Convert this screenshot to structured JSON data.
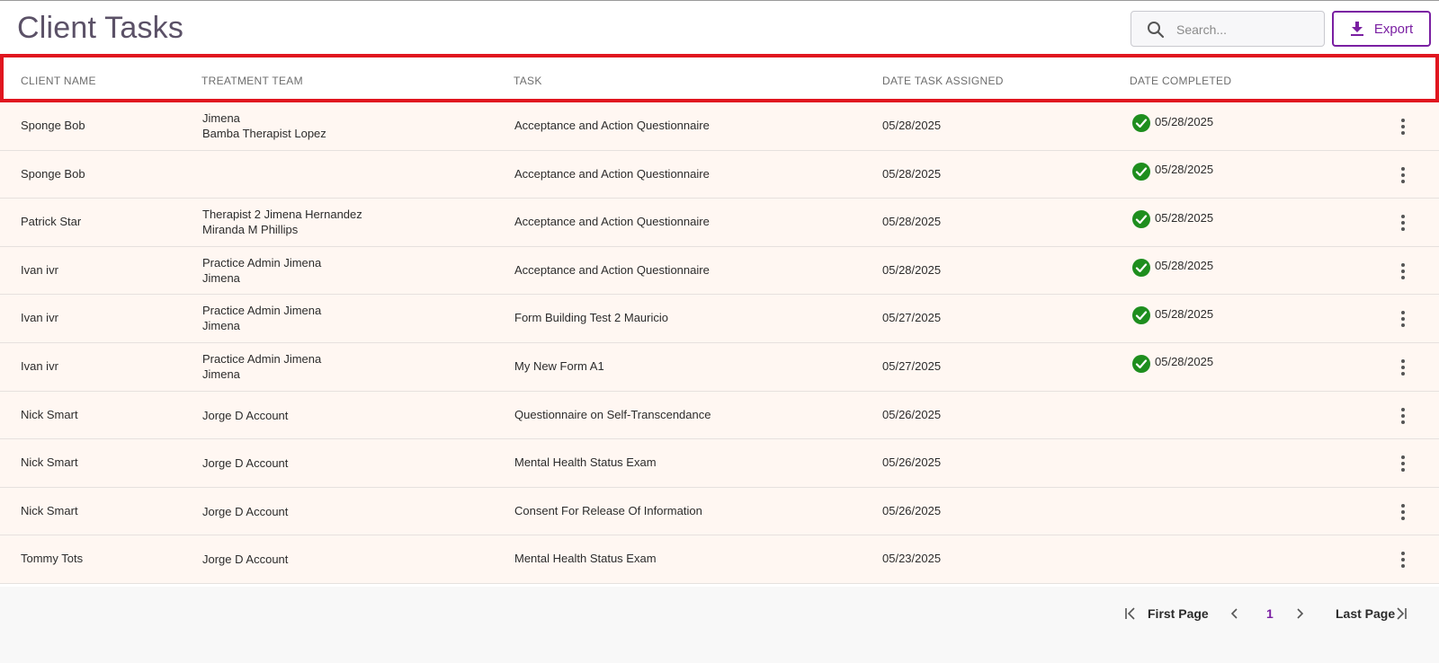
{
  "header": {
    "title": "Client Tasks",
    "search": {
      "placeholder": "Search...",
      "value": ""
    },
    "export_label": "Export"
  },
  "colors": {
    "accent": "#7a1fa2",
    "highlight_border": "#e0161f",
    "row_bg": "#fff7f2",
    "complete_icon": "#1e8e1e"
  },
  "table": {
    "columns": [
      "CLIENT NAME",
      "TREATMENT TEAM",
      "TASK",
      "DATE TASK ASSIGNED",
      "DATE COMPLETED"
    ],
    "rows": [
      {
        "client": "Sponge Bob",
        "team": [
          "Jimena",
          "Bamba Therapist Lopez"
        ],
        "task": "Acceptance and Action Questionnaire",
        "assigned": "05/28/2025",
        "completed": "05/28/2025"
      },
      {
        "client": "Sponge Bob",
        "team": [],
        "task": "Acceptance and Action Questionnaire",
        "assigned": "05/28/2025",
        "completed": "05/28/2025"
      },
      {
        "client": "Patrick Star",
        "team": [
          "Therapist 2 Jimena Hernandez",
          "Miranda M Phillips"
        ],
        "task": "Acceptance and Action Questionnaire",
        "assigned": "05/28/2025",
        "completed": "05/28/2025"
      },
      {
        "client": "Ivan ivr",
        "team": [
          "Practice Admin Jimena",
          "Jimena"
        ],
        "task": "Acceptance and Action Questionnaire",
        "assigned": "05/28/2025",
        "completed": "05/28/2025"
      },
      {
        "client": "Ivan ivr",
        "team": [
          "Practice Admin Jimena",
          "Jimena"
        ],
        "task": "Form Building Test 2 Mauricio",
        "assigned": "05/27/2025",
        "completed": "05/28/2025"
      },
      {
        "client": "Ivan ivr",
        "team": [
          "Practice Admin Jimena",
          "Jimena"
        ],
        "task": "My New Form A1",
        "assigned": "05/27/2025",
        "completed": "05/28/2025"
      },
      {
        "client": "Nick Smart",
        "team": [
          "Jorge D Account"
        ],
        "task": "Questionnaire on Self-Transcendance",
        "assigned": "05/26/2025",
        "completed": ""
      },
      {
        "client": "Nick Smart",
        "team": [
          "Jorge D Account"
        ],
        "task": "Mental Health Status Exam",
        "assigned": "05/26/2025",
        "completed": ""
      },
      {
        "client": "Nick Smart",
        "team": [
          "Jorge D Account"
        ],
        "task": "Consent For Release Of Information",
        "assigned": "05/26/2025",
        "completed": ""
      },
      {
        "client": "Tommy Tots",
        "team": [
          "Jorge D Account"
        ],
        "task": "Mental Health Status Exam",
        "assigned": "05/23/2025",
        "completed": ""
      }
    ]
  },
  "pagination": {
    "first_label": "First Page",
    "current_page": "1",
    "last_label": "Last Page"
  }
}
